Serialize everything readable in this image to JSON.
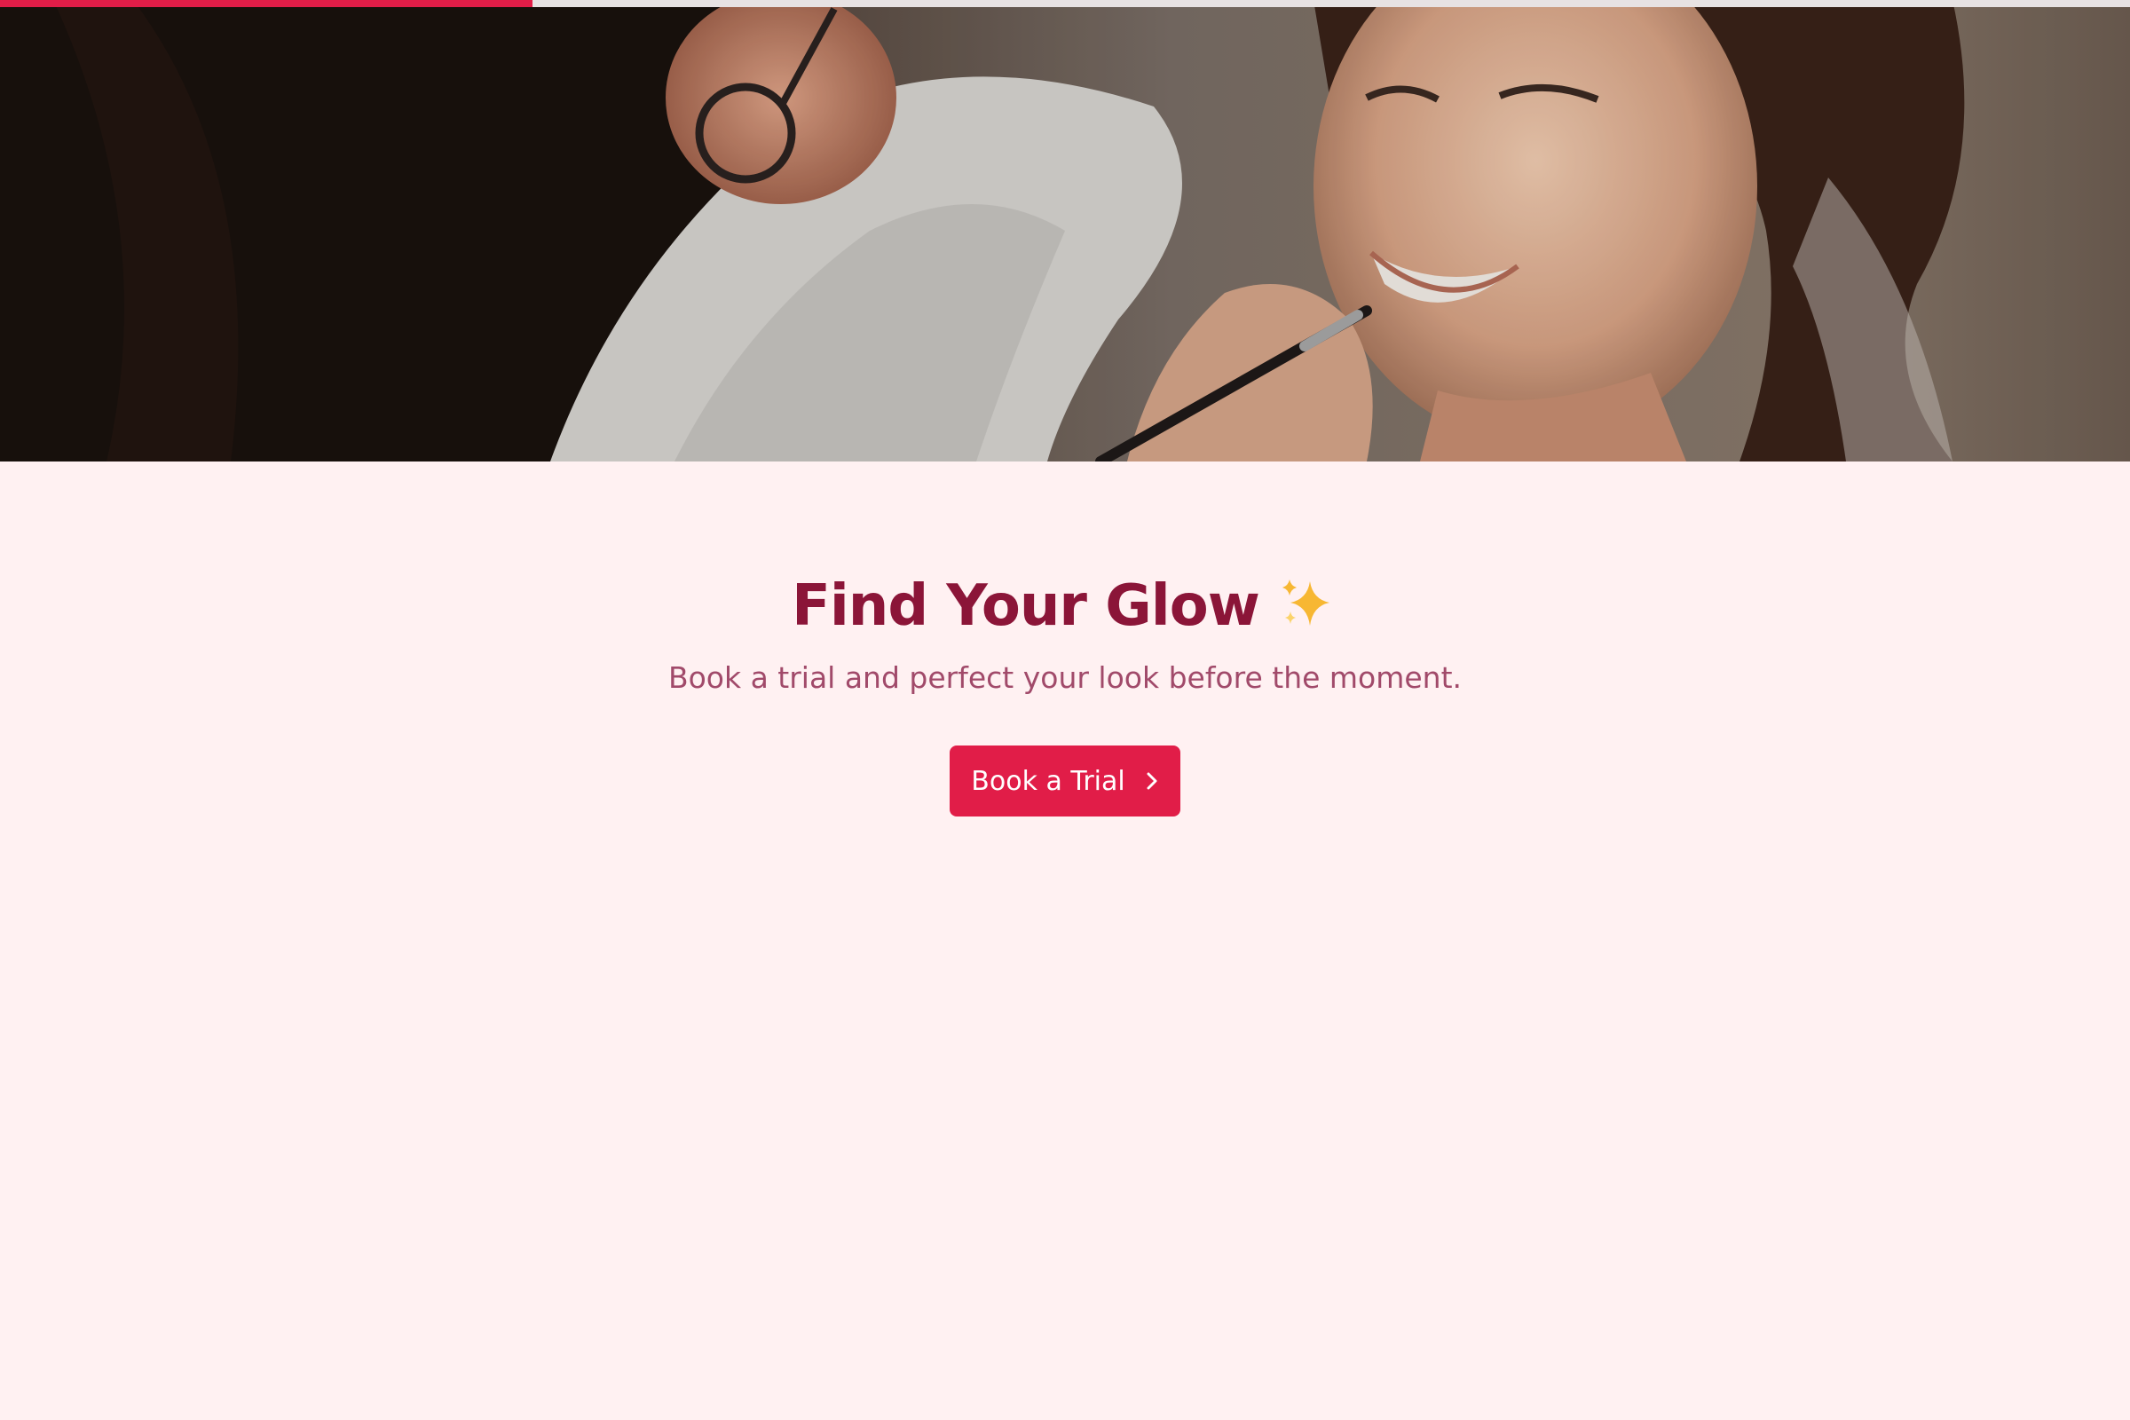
{
  "progress": {
    "value": 0.25,
    "color": "#e11d48",
    "track_color": "#e7e2e3"
  },
  "hero": {
    "image": "makeup-artist-applying-lip-brush-photo"
  },
  "main": {
    "headline": "Find Your Glow",
    "headline_icon": "sparkles-icon",
    "subtitle": "Book a trial and perfect your look before the moment.",
    "cta_label": "Book a Trial",
    "cta_icon": "chevron-right-icon"
  },
  "colors": {
    "background": "#fff1f2",
    "headline": "#8b1538",
    "subtitle": "#a14a6a",
    "accent": "#e11d48"
  }
}
